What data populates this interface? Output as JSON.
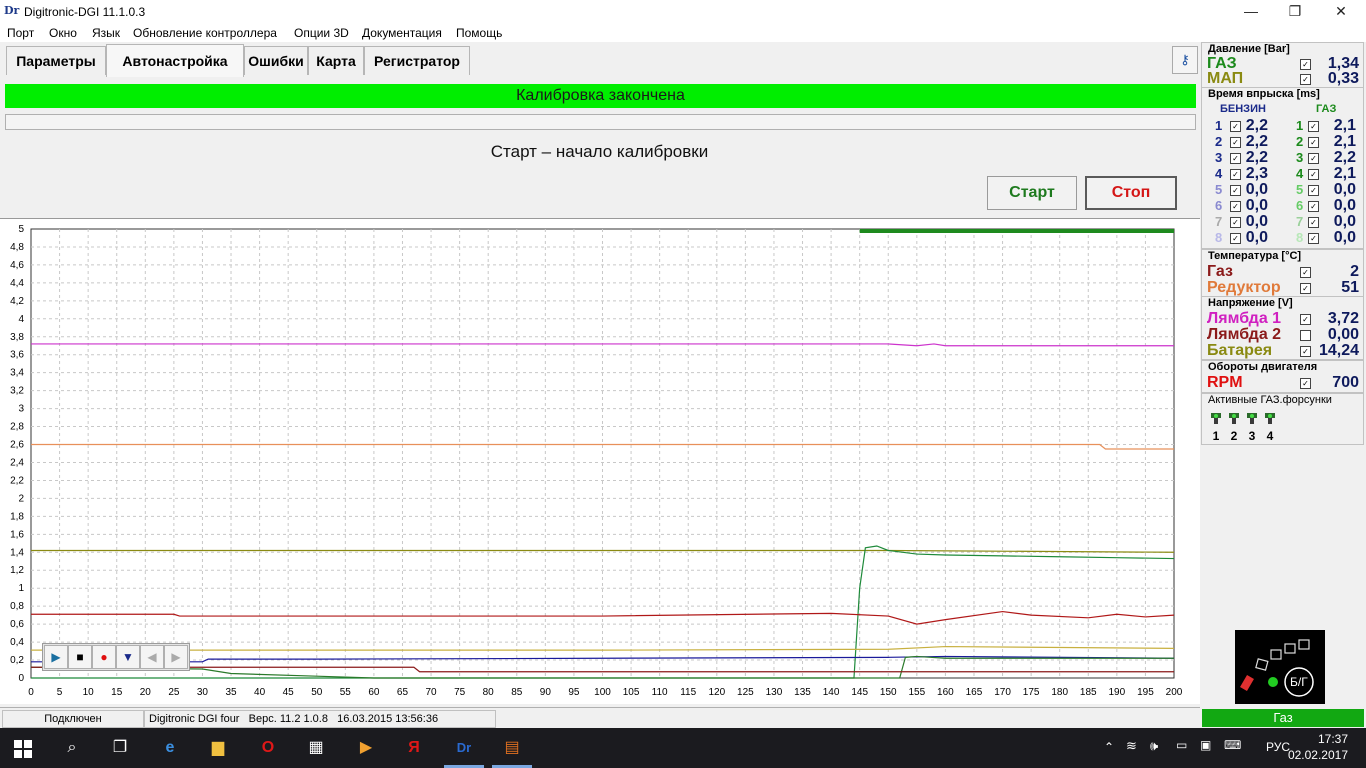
{
  "window": {
    "logo": "Dr",
    "title": "Digitronic-DGI  11.1.0.3",
    "minimize": "—",
    "maximize": "❐",
    "close": "✕"
  },
  "menu": [
    "Порт",
    "Окно",
    "Язык",
    "Обновление контроллера",
    "Опции 3D",
    "Документация",
    "Помощь"
  ],
  "tabs": [
    "Параметры",
    "Автонастройка",
    "Ошибки",
    "Карта",
    "Регистратор"
  ],
  "active_tab": "Автонастройка",
  "calibration": {
    "status": "Калибровка закончена",
    "instruction": "Старт – начало калибровки",
    "start_label": "Старт",
    "stop_label": "Стоп"
  },
  "app_status": {
    "connection": "Подключен",
    "device": "Digitronic DGI four",
    "version": "Верс. 11.2  1.0.8",
    "datetime": "16.03.2015 13:56:36"
  },
  "pressure": {
    "header": "Давление [Bar]",
    "rows": [
      {
        "label": "ГАЗ",
        "value": "1,34",
        "color": "#1b8a1b",
        "checked": true
      },
      {
        "label": "МАП",
        "value": "0,33",
        "color": "#8a8a12",
        "checked": true
      }
    ]
  },
  "injection": {
    "header": "Время впрыска [ms]",
    "petrol_label": "БЕНЗИН",
    "gas_label": "ГАЗ",
    "petrol": [
      {
        "n": "1",
        "value": "2,2"
      },
      {
        "n": "2",
        "value": "2,2"
      },
      {
        "n": "3",
        "value": "2,2"
      },
      {
        "n": "4",
        "value": "2,3"
      },
      {
        "n": "5",
        "value": "0,0"
      },
      {
        "n": "6",
        "value": "0,0"
      },
      {
        "n": "7",
        "value": "0,0"
      },
      {
        "n": "8",
        "value": "0,0"
      }
    ],
    "gas": [
      {
        "n": "1",
        "value": "2,1"
      },
      {
        "n": "2",
        "value": "2,1"
      },
      {
        "n": "3",
        "value": "2,2"
      },
      {
        "n": "4",
        "value": "2,1"
      },
      {
        "n": "5",
        "value": "0,0"
      },
      {
        "n": "6",
        "value": "0,0"
      },
      {
        "n": "7",
        "value": "0,0"
      },
      {
        "n": "8",
        "value": "0,0"
      }
    ]
  },
  "temperature": {
    "header": "Температура  [°C]",
    "rows": [
      {
        "label": "Газ",
        "value": "2",
        "color": "#8b1a1a",
        "checked": true
      },
      {
        "label": "Редуктор",
        "value": "51",
        "color": "#e07a3a",
        "checked": true
      }
    ]
  },
  "voltage": {
    "header": "Напряжение [V]",
    "rows": [
      {
        "label": "Лямбда 1",
        "value": "3,72",
        "color": "#d020c0",
        "checked": true
      },
      {
        "label": "Лямбда 2",
        "value": "0,00",
        "color": "#8b1a1a",
        "checked": false
      },
      {
        "label": "Батарея",
        "value": "14,24",
        "color": "#8a8a12",
        "checked": true
      }
    ]
  },
  "rpm": {
    "header": "Обороты двигателя",
    "label": "RPM",
    "value": "700",
    "color": "#e01010"
  },
  "active_injectors": {
    "header": "Активные ГАЗ.форсунки",
    "items": [
      "1",
      "2",
      "3",
      "4"
    ]
  },
  "gas_indicator": {
    "label": "Б/Г"
  },
  "fuel_status": "Газ",
  "taskbar": {
    "lang": "РУС",
    "time": "17:37",
    "date": "02.02.2017"
  },
  "chart_data": {
    "type": "line",
    "x_ticks": [
      0,
      5,
      10,
      15,
      20,
      25,
      30,
      35,
      40,
      45,
      50,
      55,
      60,
      65,
      70,
      75,
      80,
      85,
      90,
      95,
      100,
      105,
      110,
      115,
      120,
      125,
      130,
      135,
      140,
      145,
      150,
      155,
      160,
      165,
      170,
      175,
      180,
      185,
      190,
      195,
      200
    ],
    "y_ticks": [
      "5",
      "4,8",
      "4,6",
      "4,4",
      "4,2",
      "4",
      "3,8",
      "3,6",
      "3,4",
      "3,2",
      "3",
      "2,8",
      "2,6",
      "2,4",
      "2,2",
      "2",
      "1,8",
      "1,6",
      "1,4",
      "1,2",
      "1",
      "0,8",
      "0,6",
      "0,4",
      "0,2",
      "0"
    ],
    "xlim": [
      0,
      200
    ],
    "ylim": [
      0,
      5
    ],
    "grid": true,
    "series": [
      {
        "color": "#cc33cc",
        "x": [
          0,
          50,
          100,
          150,
          155,
          158,
          160,
          200
        ],
        "y": [
          3.72,
          3.72,
          3.72,
          3.72,
          3.7,
          3.72,
          3.7,
          3.7
        ]
      },
      {
        "color": "#e8905a",
        "x": [
          0,
          100,
          150,
          187,
          188,
          200
        ],
        "y": [
          2.6,
          2.6,
          2.6,
          2.6,
          2.55,
          2.55
        ]
      },
      {
        "color": "#8a8a12",
        "x": [
          0,
          50,
          100,
          140,
          145,
          150,
          200
        ],
        "y": [
          1.42,
          1.42,
          1.42,
          1.42,
          1.42,
          1.42,
          1.4
        ]
      },
      {
        "color": "#1e8a3a",
        "x": [
          0,
          144,
          145,
          146,
          148,
          150,
          155,
          160,
          170,
          180,
          190,
          200
        ],
        "y": [
          0.0,
          0.0,
          1.0,
          1.45,
          1.47,
          1.42,
          1.38,
          1.37,
          1.36,
          1.35,
          1.34,
          1.33
        ]
      },
      {
        "color": "#b01818",
        "x": [
          0,
          25,
          26,
          50,
          100,
          140,
          150,
          155,
          160,
          170,
          175,
          185,
          190,
          195,
          200
        ],
        "y": [
          0.71,
          0.71,
          0.69,
          0.69,
          0.69,
          0.72,
          0.69,
          0.6,
          0.65,
          0.74,
          0.7,
          0.67,
          0.71,
          0.68,
          0.7
        ]
      },
      {
        "color": "#c8b040",
        "x": [
          0,
          50,
          100,
          150,
          160,
          200
        ],
        "y": [
          0.31,
          0.31,
          0.31,
          0.32,
          0.35,
          0.33
        ]
      },
      {
        "color": "#1a1a9a",
        "x": [
          0,
          30,
          31,
          50,
          100,
          150,
          160,
          200
        ],
        "y": [
          0.18,
          0.18,
          0.21,
          0.21,
          0.22,
          0.23,
          0.24,
          0.22
        ]
      },
      {
        "color": "#2a7a2a",
        "x": [
          0,
          30,
          35,
          50,
          60,
          144,
          152,
          153,
          155,
          160,
          200
        ],
        "y": [
          0.12,
          0.1,
          0.05,
          0.02,
          0.0,
          0.0,
          0.0,
          0.23,
          0.24,
          0.22,
          0.22
        ]
      },
      {
        "color": "#8b1a1a",
        "x": [
          0,
          50,
          67,
          68,
          100,
          200
        ],
        "y": [
          0.12,
          0.12,
          0.12,
          0.07,
          0.07,
          0.07
        ]
      }
    ]
  }
}
